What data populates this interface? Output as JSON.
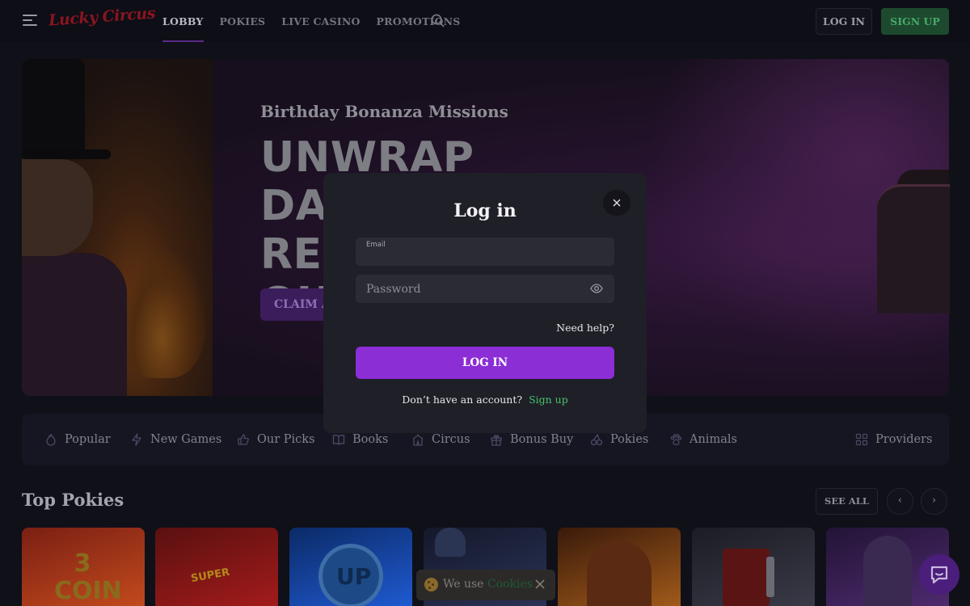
{
  "header": {
    "logo": "Lucky Circus",
    "nav": [
      "LOBBY",
      "POKIES",
      "LIVE CASINO",
      "PROMOTIONS"
    ],
    "active_nav": "LOBBY",
    "login_label": "LOG IN",
    "signup_label": "SIGN UP"
  },
  "banner": {
    "subtitle": "Birthday Bonanza Missions",
    "title_line1": "UNWRAP DAILY",
    "title_line2": "REW",
    "title_line3": "OUI",
    "cta_label": "CLAIM A"
  },
  "categories": [
    {
      "label": "Popular",
      "icon": "flame-icon"
    },
    {
      "label": "New Games",
      "icon": "lightning-icon"
    },
    {
      "label": "Our Picks",
      "icon": "thumbs-up-icon"
    },
    {
      "label": "Books",
      "icon": "book-icon"
    },
    {
      "label": "Circus",
      "icon": "tent-icon"
    },
    {
      "label": "Bonus Buy",
      "icon": "gift-icon"
    },
    {
      "label": "Pokies",
      "icon": "cherry-icon"
    },
    {
      "label": "Animals",
      "icon": "paw-icon"
    },
    {
      "label": "Providers",
      "icon": "grid-icon"
    }
  ],
  "top_pokies": {
    "title": "Top Pokies",
    "see_all_label": "SEE ALL",
    "prev_label": "‹",
    "next_label": "›",
    "tiles": [
      {
        "label": "3 COIN",
        "colors": [
          "#7a1f14",
          "#c24a1c"
        ]
      },
      {
        "label": "SUPER",
        "colors": [
          "#5a1010",
          "#a31b1b"
        ]
      },
      {
        "label": "UP",
        "colors": [
          "#0b2a66",
          "#1f5ad1"
        ]
      },
      {
        "label": "",
        "colors": [
          "#14182a",
          "#2a3356"
        ]
      },
      {
        "label": "",
        "colors": [
          "#3a1a0a",
          "#a05a1a"
        ]
      },
      {
        "label": "",
        "colors": [
          "#1c1c24",
          "#3a3a48"
        ]
      },
      {
        "label": "",
        "colors": [
          "#221436",
          "#4e2a6e"
        ]
      }
    ]
  },
  "login_modal": {
    "title": "Log in",
    "email_label": "Email",
    "email_value": "",
    "password_placeholder": "Password",
    "need_help": "Need help?",
    "submit_label": "LOG IN",
    "no_account_text": "Don’t have an account?",
    "signup_link": "Sign up"
  },
  "cookie_notice": {
    "text": "We use",
    "link": "Cookies"
  },
  "colors": {
    "accent_purple": "#8b2ed6",
    "signup_green": "#44c46e"
  }
}
